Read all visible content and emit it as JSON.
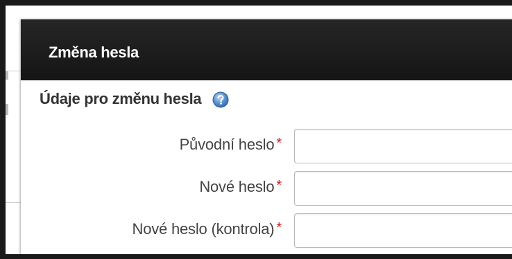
{
  "dialog": {
    "title": "Změna hesla",
    "section_heading": "Údaje pro změnu hesla",
    "help_icon": "question-mark-circle-icon",
    "fields": [
      {
        "label": "Původní heslo",
        "required_marker": "*",
        "value": ""
      },
      {
        "label": "Nové heslo",
        "required_marker": "*",
        "value": ""
      },
      {
        "label": "Nové heslo (kontrola)",
        "required_marker": "*",
        "value": ""
      }
    ]
  },
  "colors": {
    "header_bg": "#1c1c1c",
    "header_text": "#ffffff",
    "label_text": "#444444",
    "required": "#d02020",
    "help_icon": "#4a86c8"
  }
}
